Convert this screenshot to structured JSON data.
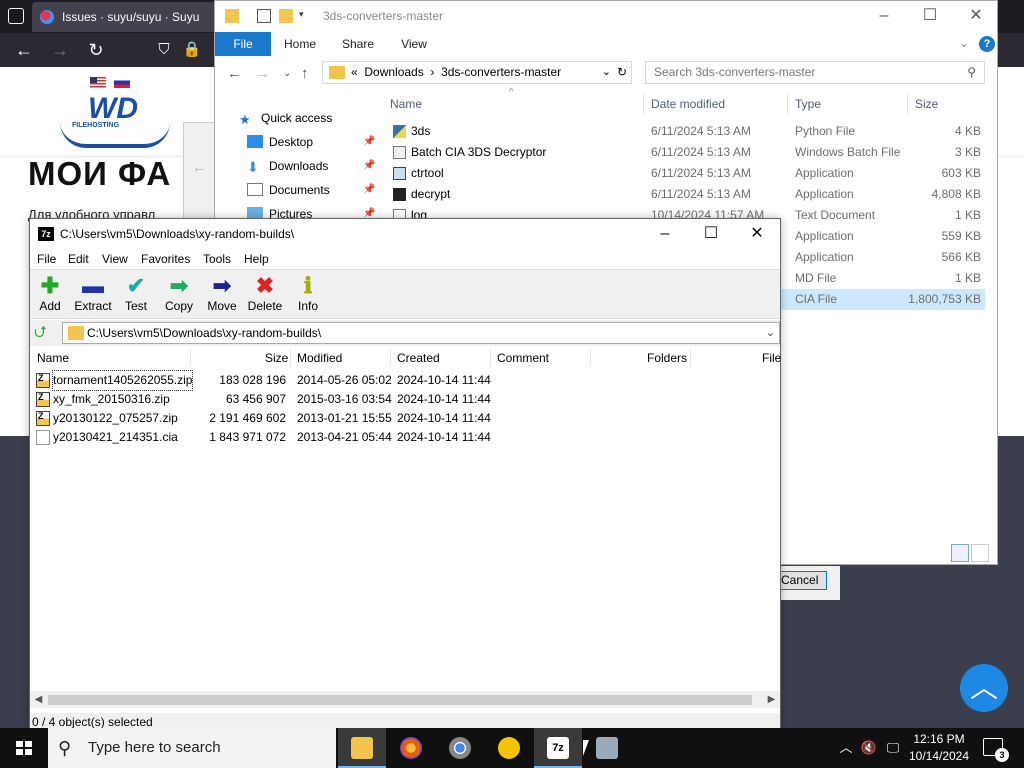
{
  "browser": {
    "tab_title": "Issues · suyu/suyu · Suyu",
    "page_heading": "МОИ ФА",
    "page_text": "Для удобного управл",
    "logo_text": "WD",
    "logo_sub": "FILEHOSTING",
    "cancel_label": "Cancel"
  },
  "explorer": {
    "title": "3ds-converters-master",
    "ribbon_tabs": [
      "File",
      "Home",
      "Share",
      "View"
    ],
    "address": {
      "crumbs": [
        "«",
        "Downloads",
        "›",
        "3ds-converters-master"
      ]
    },
    "search_placeholder": "Search 3ds-converters-master",
    "nav": [
      {
        "label": "Quick access",
        "icon": "star-icon"
      },
      {
        "label": "Desktop",
        "icon": "desktop-icon"
      },
      {
        "label": "Downloads",
        "icon": "download-icon"
      },
      {
        "label": "Documents",
        "icon": "documents-icon"
      },
      {
        "label": "Pictures",
        "icon": "pictures-icon"
      }
    ],
    "columns": [
      "Name",
      "Date modified",
      "Type",
      "Size"
    ],
    "rows": [
      {
        "name": "3ds",
        "date": "6/11/2024 5:13 AM",
        "type": "Python File",
        "size": "4 KB"
      },
      {
        "name": "Batch CIA 3DS Decryptor",
        "date": "6/11/2024 5:13 AM",
        "type": "Windows Batch File",
        "size": "3 KB"
      },
      {
        "name": "ctrtool",
        "date": "6/11/2024 5:13 AM",
        "type": "Application",
        "size": "603 KB"
      },
      {
        "name": "decrypt",
        "date": "6/11/2024 5:13 AM",
        "type": "Application",
        "size": "4,808 KB"
      },
      {
        "name": "log",
        "date": "10/14/2024 11:57 AM",
        "type": "Text Document",
        "size": "1 KB"
      },
      {
        "name": "",
        "date": "",
        "type": "Application",
        "size": "559 KB"
      },
      {
        "name": "",
        "date": "",
        "type": "Application",
        "size": "566 KB"
      },
      {
        "name": "",
        "date": "",
        "type": "MD File",
        "size": "1 KB"
      },
      {
        "name": "",
        "date": "",
        "type": "CIA File",
        "size": "1,800,753 KB"
      }
    ]
  },
  "zip": {
    "title": "C:\\Users\\vm5\\Downloads\\xy-random-builds\\",
    "menu": [
      "File",
      "Edit",
      "View",
      "Favorites",
      "Tools",
      "Help"
    ],
    "toolbar": [
      {
        "label": "Add",
        "glyph": "✚",
        "color": "#22aa22"
      },
      {
        "label": "Extract",
        "glyph": "▬",
        "color": "#2233aa"
      },
      {
        "label": "Test",
        "glyph": "✔",
        "color": "#22aaaa"
      },
      {
        "label": "Copy",
        "glyph": "➡",
        "color": "#22aa66"
      },
      {
        "label": "Move",
        "glyph": "➡",
        "color": "#222288"
      },
      {
        "label": "Delete",
        "glyph": "✖",
        "color": "#dd2222"
      },
      {
        "label": "Info",
        "glyph": "ℹ",
        "color": "#aaaa00"
      }
    ],
    "path": "C:\\Users\\vm5\\Downloads\\xy-random-builds\\",
    "columns": [
      "Name",
      "Size",
      "Modified",
      "Created",
      "Comment",
      "Folders",
      "File"
    ],
    "rows": [
      {
        "name": "tornament1405262055.zip",
        "size": "183 028 196",
        "modified": "2014-05-26 05:02",
        "created": "2024-10-14 11:44",
        "kind": "zip"
      },
      {
        "name": "xy_fmk_20150316.zip",
        "size": "63 456 907",
        "modified": "2015-03-16 03:54",
        "created": "2024-10-14 11:44",
        "kind": "zip"
      },
      {
        "name": "y20130122_075257.zip",
        "size": "2 191 469 602",
        "modified": "2013-01-21 15:55",
        "created": "2024-10-14 11:44",
        "kind": "zip"
      },
      {
        "name": "y20130421_214351.cia",
        "size": "1 843 971 072",
        "modified": "2013-04-21 05:44",
        "created": "2024-10-14 11:44",
        "kind": "file"
      }
    ],
    "status": "0 / 4 object(s) selected"
  },
  "taskbar": {
    "search_placeholder": "Type here to search",
    "time": "12:16 PM",
    "date": "10/14/2024",
    "notifications": "3"
  }
}
